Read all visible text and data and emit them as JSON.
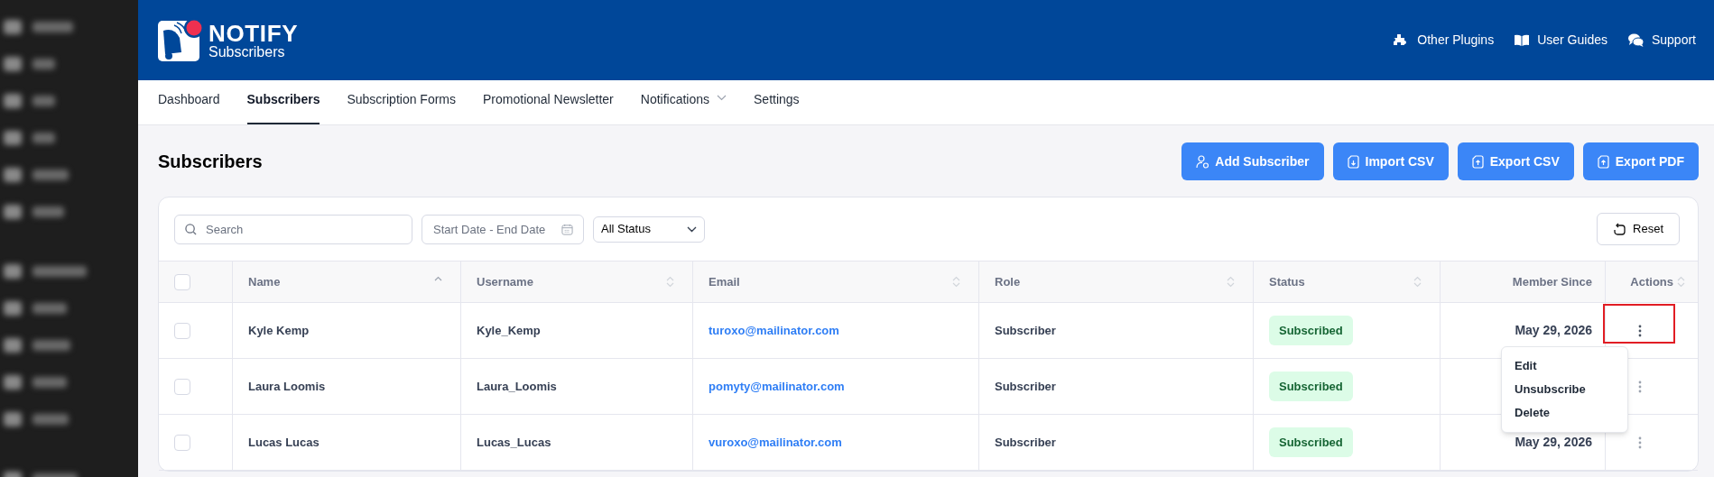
{
  "header": {
    "logo_title": "NOTIFY",
    "logo_subtitle": "Subscribers",
    "links": [
      {
        "kind": "puzzle",
        "label": "Other Plugins"
      },
      {
        "kind": "book",
        "label": "User Guides"
      },
      {
        "kind": "chat",
        "label": "Support"
      }
    ]
  },
  "tabs": [
    {
      "label": "Dashboard",
      "selected": false,
      "has_dropdown": false
    },
    {
      "label": "Subscribers",
      "selected": true,
      "has_dropdown": false
    },
    {
      "label": "Subscription Forms",
      "selected": false,
      "has_dropdown": false
    },
    {
      "label": "Promotional Newsletter",
      "selected": false,
      "has_dropdown": false
    },
    {
      "label": "Notifications",
      "selected": false,
      "has_dropdown": true
    },
    {
      "label": "Settings",
      "selected": false,
      "has_dropdown": false
    }
  ],
  "page_title": "Subscribers",
  "buttons": [
    {
      "kind": "user",
      "label": "Add Subscriber"
    },
    {
      "kind": "import",
      "label": "Import CSV"
    },
    {
      "kind": "export",
      "label": "Export CSV"
    },
    {
      "kind": "export",
      "label": "Export PDF"
    }
  ],
  "filters": {
    "search": {
      "placeholder": "Search"
    },
    "date_range": {
      "placeholder": "Start Date - End Date"
    },
    "status": {
      "value": "All Status"
    },
    "reset": "Reset"
  },
  "table": {
    "select_all_checked": false,
    "columns": [
      {
        "label": "Name",
        "sortable": true,
        "sorted": true
      },
      {
        "label": "Username",
        "sortable": true,
        "sorted": false
      },
      {
        "label": "Email",
        "sortable": true,
        "sorted": false
      },
      {
        "label": "Role",
        "sortable": true,
        "sorted": false
      },
      {
        "label": "Status",
        "sortable": true,
        "sorted": false
      },
      {
        "label": "Member Since",
        "sortable": false
      },
      {
        "label": "Actions",
        "sortable": true,
        "sorted": false
      }
    ],
    "rows": [
      {
        "checked": false,
        "name": "Kyle Kemp",
        "username": "Kyle_Kemp",
        "email": "turoxo@mailinator.com",
        "role": "Subscriber",
        "status": "Subscribed",
        "member_since": "May 29, 2026",
        "menu_open": true,
        "highlighted": true
      },
      {
        "checked": false,
        "name": "Laura Loomis",
        "username": "Laura_Loomis",
        "email": "pomyty@mailinator.com",
        "role": "Subscriber",
        "status": "Subscribed",
        "menu_open": false,
        "highlighted": false
      },
      {
        "checked": false,
        "name": "Lucas Lucas",
        "username": "Lucas_Lucas",
        "email": "vuroxo@mailinator.com",
        "role": "Subscriber",
        "status": "Subscribed",
        "member_since": "May 29, 2026",
        "menu_open": false,
        "highlighted": false
      }
    ]
  },
  "action_menu": [
    "Edit",
    "Unsubscribe",
    "Delete"
  ]
}
